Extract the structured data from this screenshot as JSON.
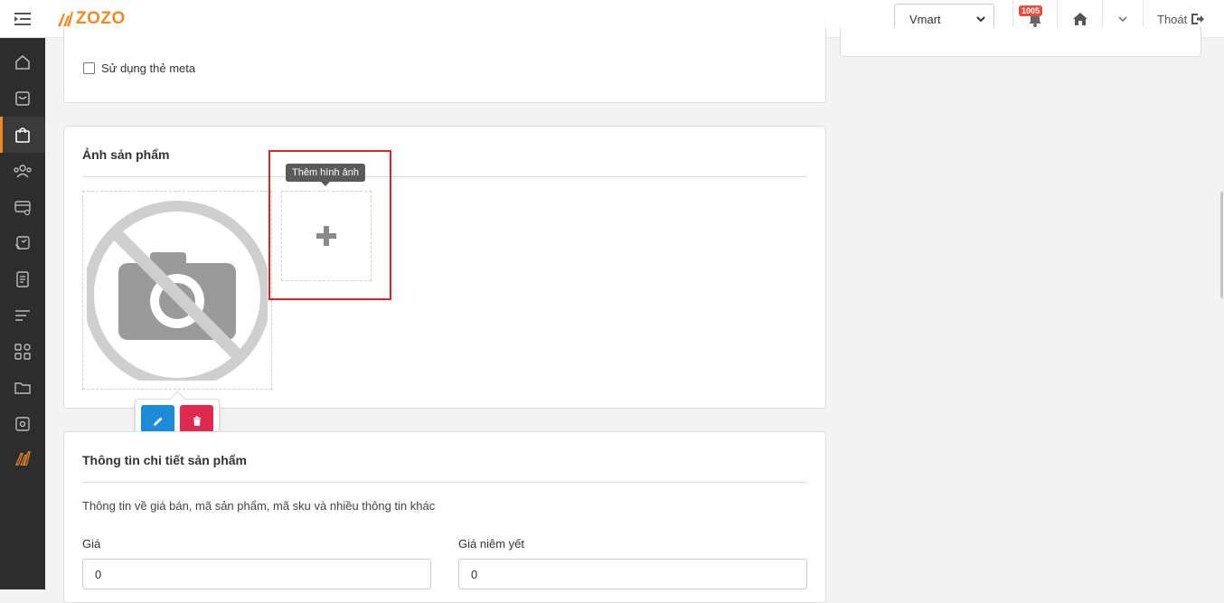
{
  "header": {
    "logo_text": "ZOZO",
    "shop_selected": "Vmart",
    "notification_count": "1005",
    "logout_label": "Thoát"
  },
  "sidebar": {
    "items": [
      "home",
      "orders",
      "products",
      "customers",
      "promotions",
      "channels",
      "reports",
      "content",
      "apps",
      "files",
      "settings",
      "brand"
    ],
    "active": "products"
  },
  "meta": {
    "use_meta_label": "Sử dụng thẻ meta"
  },
  "images": {
    "title": "Ảnh sản phẩm",
    "add_tooltip": "Thêm hình ảnh"
  },
  "detail": {
    "title": "Thông tin chi tiết sản phẩm",
    "description": "Thông tin về giá bán, mã sản phẩm, mã sku và nhiều thông tin khác",
    "price_label": "Giá",
    "price_value": "0",
    "list_price_label": "Giá niêm yết",
    "list_price_value": "0"
  },
  "colors": {
    "brand": "#f08a24",
    "sidebar_bg": "#2d2d2d",
    "edit_button": "#1e8bd6",
    "delete_button": "#e0294f",
    "highlight": "#d62728"
  }
}
